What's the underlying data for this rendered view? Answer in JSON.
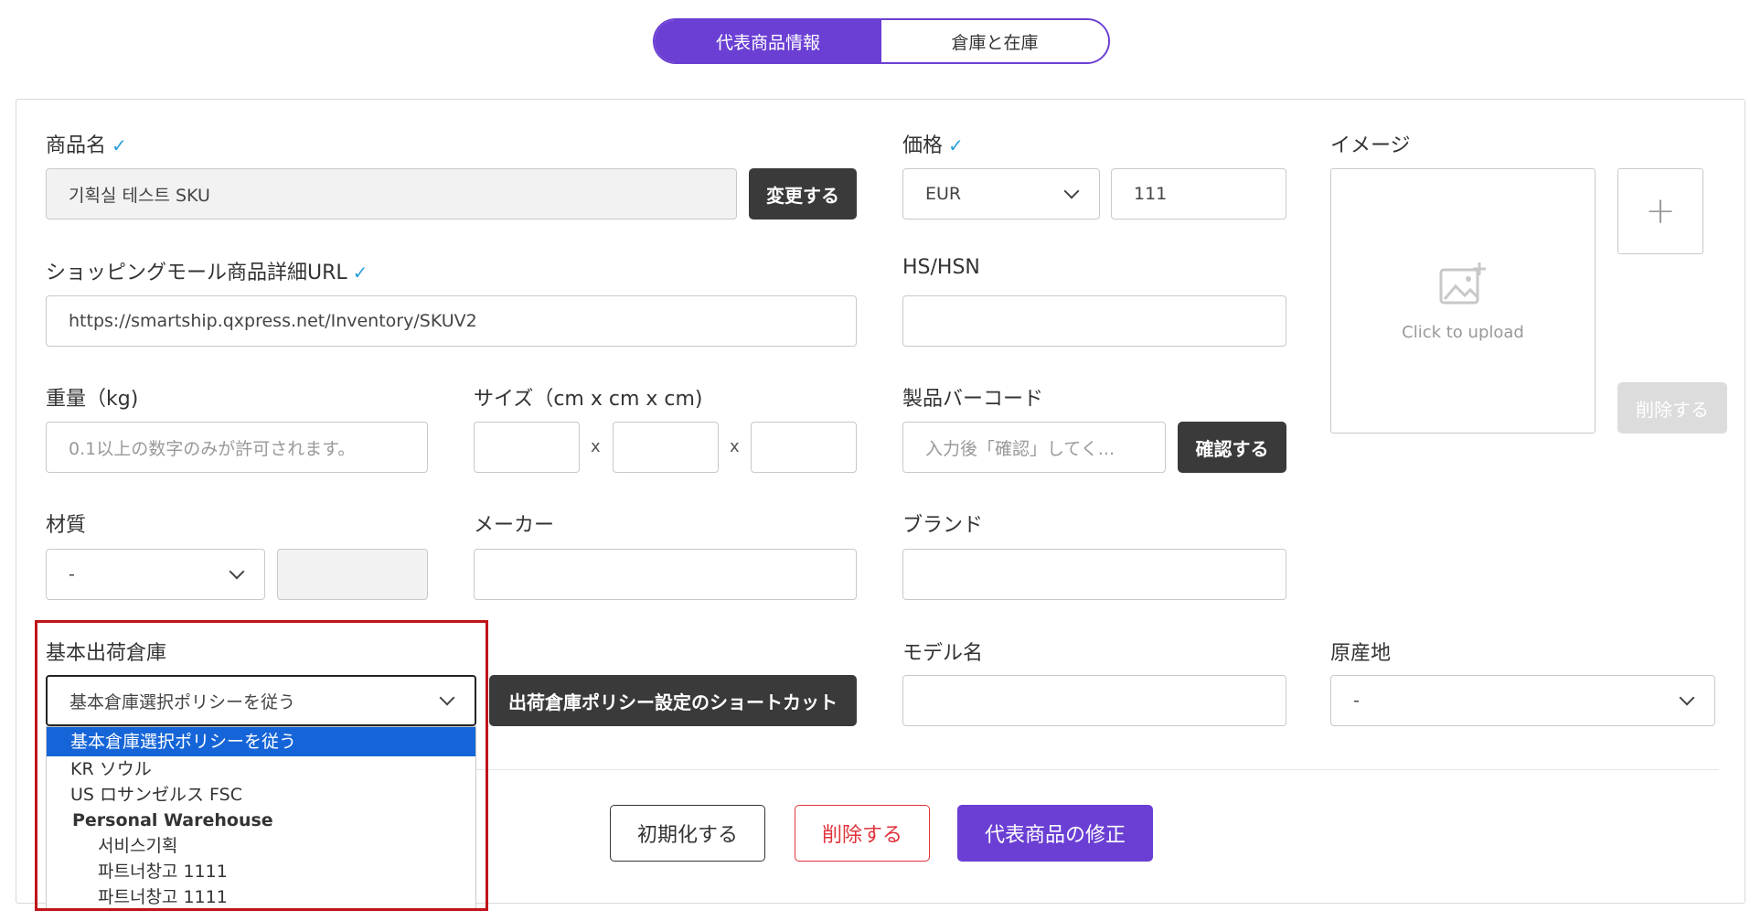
{
  "tabs": [
    {
      "label": "代表商品情報",
      "active": true
    },
    {
      "label": "倉庫と在庫",
      "active": false
    }
  ],
  "fields": {
    "product_name": {
      "label": "商品名",
      "value": "기획실 테스트 SKU",
      "change_button": "変更する"
    },
    "price": {
      "label": "価格",
      "currency": "EUR",
      "value": "111"
    },
    "image": {
      "label": "イメージ",
      "upload_text": "Click to upload",
      "delete_button": "削除する"
    },
    "mall_url": {
      "label": "ショッピングモール商品詳細URL",
      "value": "https://smartship.qxpress.net/Inventory/SKUV2"
    },
    "hs_hsn": {
      "label": "HS/HSN",
      "value": ""
    },
    "weight": {
      "label": "重量（kg)",
      "placeholder": "0.1以上の数字のみが許可されます。"
    },
    "size": {
      "label": "サイズ（cm x cm x cm)",
      "separator": "x"
    },
    "barcode": {
      "label": "製品バーコード",
      "placeholder": "入力後「確認」してく...",
      "confirm_button": "確認する"
    },
    "material": {
      "label": "材質",
      "value": "-"
    },
    "maker": {
      "label": "メーカー",
      "value": ""
    },
    "brand": {
      "label": "ブランド",
      "value": ""
    },
    "warehouse": {
      "label": "基本出荷倉庫",
      "value": "基本倉庫選択ポリシーを従う",
      "shortcut_button": "出荷倉庫ポリシー設定のショートカット"
    },
    "model": {
      "label": "モデル名",
      "value": ""
    },
    "origin": {
      "label": "原産地",
      "value": "-"
    }
  },
  "warehouse_options": [
    {
      "label": "基本倉庫選択ポリシーを従う",
      "kind": "selected"
    },
    {
      "label": "KR ソウル",
      "kind": "item"
    },
    {
      "label": "US ロサンゼルス FSC",
      "kind": "item"
    },
    {
      "label": "Personal Warehouse",
      "kind": "group"
    },
    {
      "label": "서비스기획",
      "kind": "sub"
    },
    {
      "label": "파트너창고 1111",
      "kind": "sub"
    },
    {
      "label": "파트너창고 1111",
      "kind": "sub"
    }
  ],
  "actions": {
    "reset": "初期化する",
    "delete": "削除する",
    "update": "代表商品の修正"
  },
  "colors": {
    "accent": "#6b3fd4",
    "highlight_box": "#c0141b",
    "selected_option": "#1565d8",
    "delete_text": "#e0323a"
  },
  "icons": {
    "check": "check-icon",
    "chevron": "chevron-down-icon",
    "image": "image-add-icon",
    "plus": "plus-icon"
  }
}
